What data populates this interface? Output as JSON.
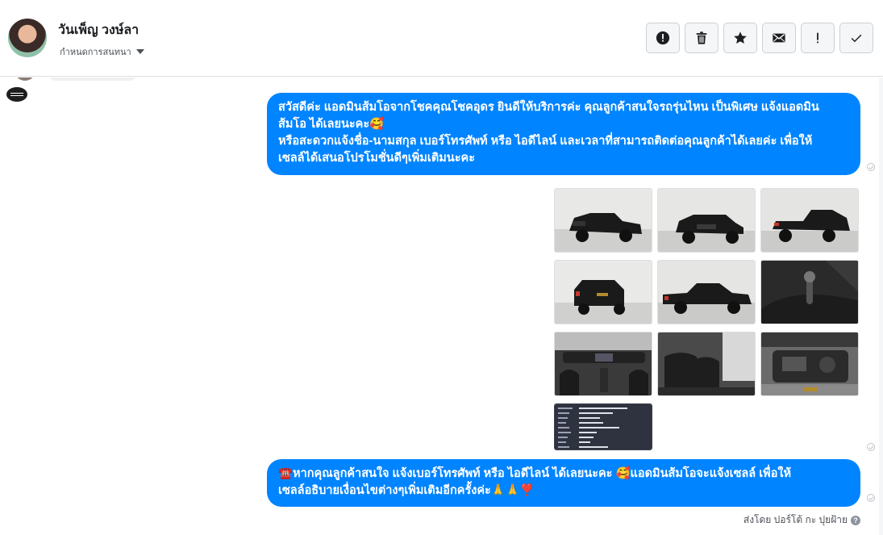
{
  "header": {
    "contact_name": "วันเพ็ญ วงษ์ลา",
    "assign_label": "กำหนดการสนทนา"
  },
  "toolbar": [
    {
      "name": "report-button",
      "icon": "alert-circle-icon"
    },
    {
      "name": "delete-button",
      "icon": "trash-icon"
    },
    {
      "name": "star-button",
      "icon": "star-icon"
    },
    {
      "name": "mark-unread-button",
      "icon": "envelope-icon"
    },
    {
      "name": "flag-button",
      "icon": "exclamation-icon"
    },
    {
      "name": "mark-done-button",
      "icon": "check-icon"
    }
  ],
  "messages": {
    "first": {
      "line1": "สวัสดีค่ะ แอดมินส้มโอจากโชคคุณโชคอุดร ยินดีให้บริการค่ะ   คุณลูกค้าสนใจรถรุ่นไหน เป็นพิเศษ แจ้งแอดมิน",
      "line2": "ส้มโอ ได้เลยนะคะ🥰",
      "line3": "หรือสะดวกแจ้งชื่อ-นามสกุล เบอร์โทรศัพท์ หรือ ไอดีไลน์ และเวลาที่สามารถติดต่อคุณลูกค้าได้เลยค่ะ เพื่อให้",
      "line4": "เซลล์ได้เสนอโปรโมชั่นดีๆเพิ่มเติมนะคะ"
    },
    "second": {
      "line1": "☎️หากคุณลูกค้าสนใจ แจ้งเบอร์โทรศัพท์ หรือ ไอดีไลน์  ได้เลยนะคะ 🥰แอดมินส้มโอจะแจ้งเซลล์     เพื่อให้",
      "line2": "เซลล์อธิบายเงื่อนไขต่างๆเพิ่มเติมอีกครั้งค่ะ🙏🙏❣️"
    }
  },
  "photos": [
    {
      "name": "photo-truck-front-left",
      "kind": "ext"
    },
    {
      "name": "photo-truck-front",
      "kind": "ext"
    },
    {
      "name": "photo-truck-rear-left",
      "kind": "ext"
    },
    {
      "name": "photo-truck-rear",
      "kind": "ext"
    },
    {
      "name": "photo-truck-side",
      "kind": "ext"
    },
    {
      "name": "photo-gear-shift",
      "kind": "int"
    },
    {
      "name": "photo-dashboard",
      "kind": "int"
    },
    {
      "name": "photo-rear-seats",
      "kind": "int"
    },
    {
      "name": "photo-engine-bay",
      "kind": "int"
    },
    {
      "name": "photo-info-card",
      "kind": "doc"
    }
  ],
  "footer": {
    "sent_by": "ส่งโดย ปอร์โต้ กะ ปุยฝ้าย"
  }
}
